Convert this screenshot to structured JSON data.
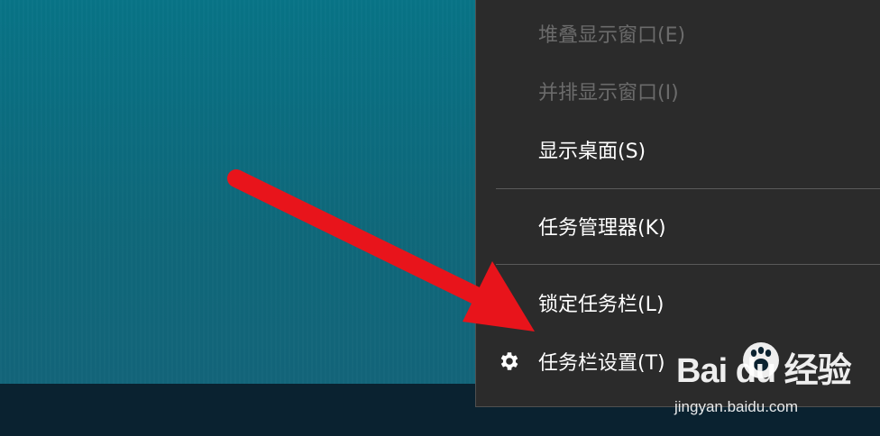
{
  "context_menu": {
    "items": [
      {
        "label": "堆叠显示窗口(E)",
        "enabled": false
      },
      {
        "label": "并排显示窗口(I)",
        "enabled": false
      },
      {
        "label": "显示桌面(S)",
        "enabled": true
      },
      {
        "label": "任务管理器(K)",
        "enabled": true
      },
      {
        "label": "锁定任务栏(L)",
        "enabled": true
      },
      {
        "label": "任务栏设置(T)",
        "enabled": true,
        "icon": "gear-icon"
      }
    ]
  },
  "annotation": {
    "arrow_color": "#e8141b",
    "icon": "arrow-icon"
  },
  "watermark": {
    "brand": "Bai du 经验",
    "url": "jingyan.baidu.com",
    "icon": "baidu-paw-icon"
  },
  "colors": {
    "desktop": "#0b6d80",
    "taskbar": "#0a2230",
    "menu_background": "#2b2b2b",
    "menu_text": "#ffffff",
    "menu_text_disabled": "#6b6b6b"
  }
}
